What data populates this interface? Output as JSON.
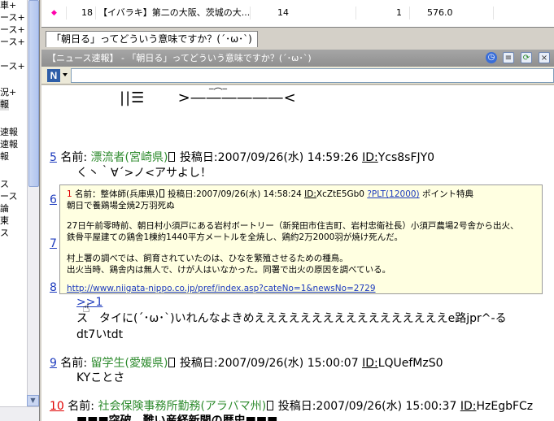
{
  "sidebar": {
    "items": [
      "車+",
      "ース+",
      "ース+",
      "ース+",
      "ース+",
      "",
      "況+",
      "報",
      "",
      "速報",
      "速報",
      "報",
      "",
      "ス",
      "ース",
      "論",
      "東",
      "ス"
    ]
  },
  "thread_list": {
    "rows": [
      {
        "mark": "◆",
        "no": "18",
        "title": "【イバラキ】第二の大阪、茨城の大...",
        "count": "14",
        "new": "1",
        "speed": "576.0"
      }
    ]
  },
  "tab": {
    "label": "「朝日る」ってどういう意味ですか？(´･ω･`)"
  },
  "titlebar": {
    "title": "【ニュース速報】 - 「朝日る」ってどういう意味ですか？(´･ω･`)"
  },
  "addr": {
    "value": ""
  },
  "content": {
    "aa_line1": "||☰      >――――――<",
    "aa_smile": "‾⌒‾",
    "posts": [
      {
        "num": "5",
        "label": "名前:",
        "name": "漂流者(宮崎県)",
        "posted_label": "投稿日:",
        "date": "2007/09/26(水) 14:59:26",
        "id_label": "ID:",
        "id": "Ycs8sFJY0",
        "body": "く丶｀∀´>ノ<アサよし！"
      },
      {
        "num": "9",
        "label": "名前:",
        "name": "留学生(愛媛県)",
        "posted_label": "投稿日:",
        "date": "2007/09/26(水) 15:00:07",
        "id_label": "ID:",
        "id": "LQUefMzS0",
        "body": "KYことさ"
      },
      {
        "num": "10",
        "label": "名前:",
        "name": "社会保険事務所勤務(アラバマ州)",
        "posted_label": "投稿日:",
        "date": "2007/09/26(水) 15:00:37",
        "id_label": "ID:",
        "id": "HzEgbFCz",
        "body": "■■■突破　難い産経新聞の歴史■■■"
      }
    ],
    "side_nums": [
      "6",
      "7",
      "8"
    ],
    "reply_link": ">>1",
    "post8_body1": "ス　タイに(´･ω･`)いれんなよきめえええええええええええええええええe路jpr^-る",
    "post8_body2": "dt7いtdt"
  },
  "popup": {
    "num": "1",
    "header": "名前：整体師(兵庫県)",
    "date": "投稿日:2007/09/26(水) 14:58:24",
    "id_label": "ID:",
    "id": "XcZtE5Gb0",
    "plt": "?PLT(12000)",
    "tail": "ポイント特典",
    "l1": "朝日で養鶏場全焼2万羽死ぬ",
    "l2": "27日午前零時前、朝日村小須戸にある岩村ボートリー（新発田市住吉町、岩村忠衛社長）小須戸農場2号舎から出火、",
    "l3": "鉄骨平屋建ての鶏舎1棟約1440平方メートルを全焼し、鶏約2万2000羽が焼け死んだ。",
    "l4": "村上署の調べでは、飼育されていたのは、ひなを繁殖させるための種鳥。",
    "l5": "出火当時、鶏舎内は無人で、けが人はいなかった。同署で出火の原因を調べている。",
    "url": "http://www.niigata-nippo.co.jp/pref/index.asp?cateNo=1&newsNo=2729"
  }
}
